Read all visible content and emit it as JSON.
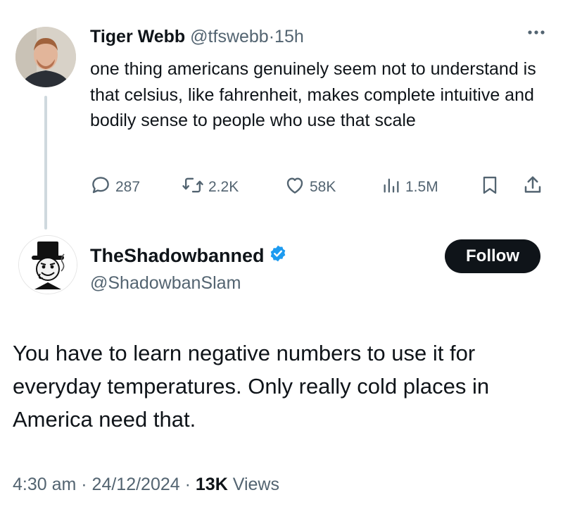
{
  "tweet1": {
    "author_name": "Tiger Webb",
    "handle": "@tfswebb",
    "separator": "·",
    "time": "15h",
    "text": "one thing americans genuinely seem not to understand is that celsius, like fahrenheit, makes complete intuitive and bodily sense to people who use that scale",
    "stats": {
      "replies": "287",
      "reposts": "2.2K",
      "likes": "58K",
      "views": "1.5M"
    }
  },
  "tweet2": {
    "author_name": "TheShadowbanned",
    "handle": "@ShadowbanSlam",
    "verified": true,
    "follow_label": "Follow",
    "text": "You have to learn negative numbers to use it for everyday temperatures. Only really cold places in America need that.",
    "meta": {
      "time_date": "4:30 am · 24/12/2024 ·",
      "views_count": "13K",
      "views_label": "Views"
    }
  },
  "icons": {
    "more": "more-dots-icon",
    "reply": "reply-bubble-icon",
    "repost": "repost-arrows-icon",
    "like": "heart-icon",
    "views": "bar-chart-icon",
    "bookmark": "bookmark-icon",
    "share": "share-upload-icon",
    "verified": "verified-badge-icon"
  },
  "colors": {
    "text": "#0f1419",
    "secondary": "#536471",
    "verified": "#1d9bf0",
    "thread_line": "#cfd9de",
    "follow_bg": "#0f1419"
  }
}
